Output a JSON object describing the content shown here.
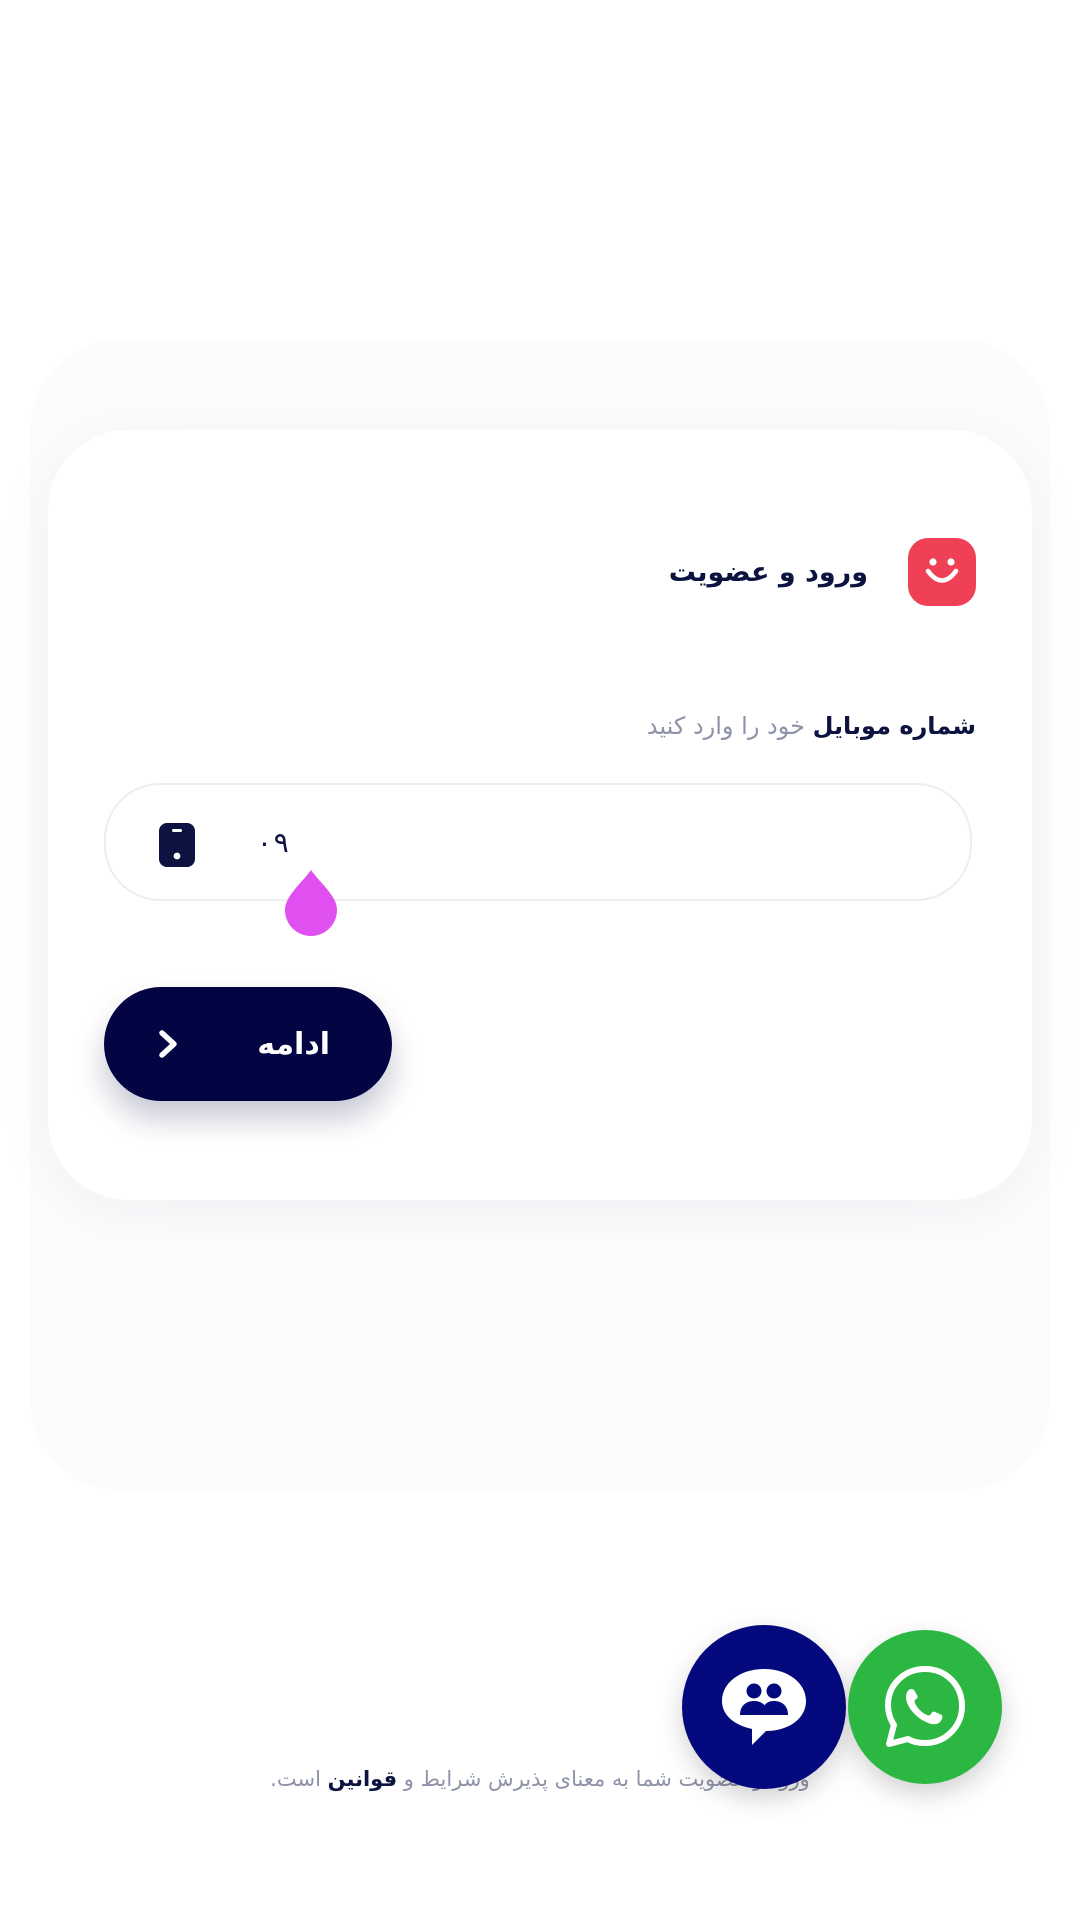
{
  "header": {
    "title": "ورود و عضویت",
    "logo_icon": "smile-icon",
    "logo_color": "#ef4056"
  },
  "form": {
    "label_strong": "شماره موبایل",
    "label_light": "خود را وارد کنید",
    "phone_value": "۰۹",
    "phone_icon": "mobile-phone-icon"
  },
  "continue_button": {
    "label": "ادامه",
    "icon": "chevron-right-icon",
    "color": "#020541"
  },
  "terms": {
    "prefix": "ورود و عضویت شما به معنای پذیرش شرایط و",
    "link": "قوانین",
    "suffix": "است."
  },
  "fabs": {
    "support_icon": "support-chat-icon",
    "support_color": "#05097e",
    "whatsapp_icon": "whatsapp-icon",
    "whatsapp_color": "#2bb741"
  }
}
